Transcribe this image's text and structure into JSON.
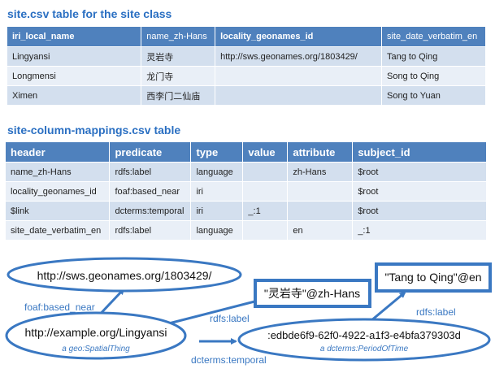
{
  "table1": {
    "title": "site.csv table for the site class",
    "headers": [
      "iri_local_name",
      "name_zh-Hans",
      "locality_geonames_id",
      "site_date_verbatim_en"
    ],
    "rows": [
      [
        "Lingyansi",
        "灵岩寺",
        "http://sws.geonames.org/1803429/",
        "Tang to Qing"
      ],
      [
        "Longmensi",
        "龙门寺",
        "",
        "Song to Qing"
      ],
      [
        "Ximen",
        "西李门二仙庙",
        "",
        "Song to Yuan"
      ]
    ]
  },
  "table2": {
    "title": "site-column-mappings.csv table",
    "headers": [
      "header",
      "predicate",
      "type",
      "value",
      "attribute",
      "subject_id"
    ],
    "rows": [
      [
        "name_zh-Hans",
        "rdfs:label",
        "language",
        "",
        "zh-Hans",
        "$root"
      ],
      [
        "locality_geonames_id",
        "foaf:based_near",
        "iri",
        "",
        "",
        "$root"
      ],
      [
        "$link",
        "dcterms:temporal",
        "iri",
        "_:1",
        "",
        "$root"
      ],
      [
        "site_date_verbatim_en",
        "rdfs:label",
        "language",
        "",
        "en",
        "_:1"
      ]
    ]
  },
  "graph": {
    "nodes": {
      "geonames": "http://sws.geonames.org/1803429/",
      "lingyansi": "http://example.org/Lingyansi",
      "lingyansi_type": "a geo:SpatialThing",
      "zh_label": "\"灵岩寺\"@zh-Hans",
      "en_label": "\"Tang to Qing\"@en",
      "blank": ":edbde6f9-62f0-4922-a1f3-e4bfa379303d",
      "blank_type": "a dcterms:PeriodOfTime"
    },
    "edges": {
      "based_near": "foaf:based_near",
      "label_zh": "rdfs:label",
      "label_en": "rdfs:label",
      "temporal": "dcterms:temporal"
    },
    "accent": "#3a78c2"
  }
}
